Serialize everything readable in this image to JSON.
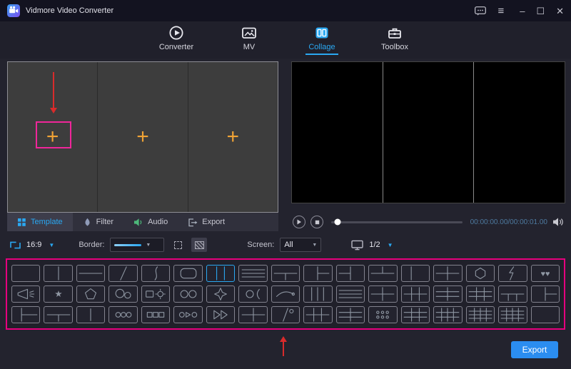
{
  "titlebar": {
    "title": "Vidmore Video Converter",
    "minimize": "–",
    "maximize": "☐",
    "close": "✕",
    "menu": "≡"
  },
  "nav": {
    "tabs": [
      {
        "label": "Converter",
        "icon": "play-disc-icon",
        "active": false
      },
      {
        "label": "MV",
        "icon": "picture-icon",
        "active": false
      },
      {
        "label": "Collage",
        "icon": "collage-icon",
        "active": true
      },
      {
        "label": "Toolbox",
        "icon": "toolbox-icon",
        "active": false
      }
    ]
  },
  "editor": {
    "plus": "+",
    "panel_count": 3
  },
  "preview": {
    "panel_count": 3
  },
  "panel_tabs": [
    {
      "label": "Template",
      "icon": "template-grid-icon",
      "active": true
    },
    {
      "label": "Filter",
      "icon": "filter-drop-icon",
      "active": false
    },
    {
      "label": "Audio",
      "icon": "speaker-icon",
      "active": false
    },
    {
      "label": "Export",
      "icon": "export-arrow-icon",
      "active": false
    }
  ],
  "playback": {
    "time": "00:00:00.00/00:00:01.00"
  },
  "toolbar": {
    "aspect_ratio": "16:9",
    "border_label": "Border:",
    "screen_label": "Screen:",
    "screen_value": "All",
    "page_indicator": "1/2"
  },
  "templates": {
    "selected": {
      "row": 0,
      "col": 6
    },
    "rows": [
      [
        "single",
        "two-cols",
        "two-rows",
        "diagonal",
        "curve-split",
        "rounded-frame",
        "three-cols",
        "four-rows",
        "top-full-bottom-two",
        "left-full-right-two",
        "right-full-left-two",
        "bottom-full-top-two",
        "left-col",
        "grid-2x2",
        "hexagon",
        "lightning",
        "hearts"
      ],
      [
        "megaphone",
        "star",
        "pentagon",
        "two-circles-offset",
        "frame-gear",
        "two-circles",
        "four-point-star",
        "circle-bracket",
        "swoosh",
        "four-cols",
        "four-rows",
        "grid-2x2",
        "grid-3x2",
        "grid-2x3",
        "grid-3x3",
        "top-full-bottom-three",
        "left-full-right-two"
      ],
      [
        "left-col-right-two",
        "top-full-bottom-two",
        "thick-divider",
        "three-circles",
        "three-squares",
        "circle-tri-circle",
        "fast-forward",
        "grid-2x2",
        "diagonal-circle",
        "grid-3x2",
        "grid-2x3",
        "dots-grid",
        "grid-3x3",
        "grid-4x3",
        "grid-4x4",
        "grid-4x4",
        "single"
      ]
    ]
  },
  "footer": {
    "export_label": "Export"
  },
  "colors": {
    "accent_blue": "#2aa8f2",
    "highlight_magenta": "#f0269a",
    "arrow_red": "#d92b2b",
    "plus_orange": "#f0a335",
    "export_blue": "#2b8df0"
  }
}
